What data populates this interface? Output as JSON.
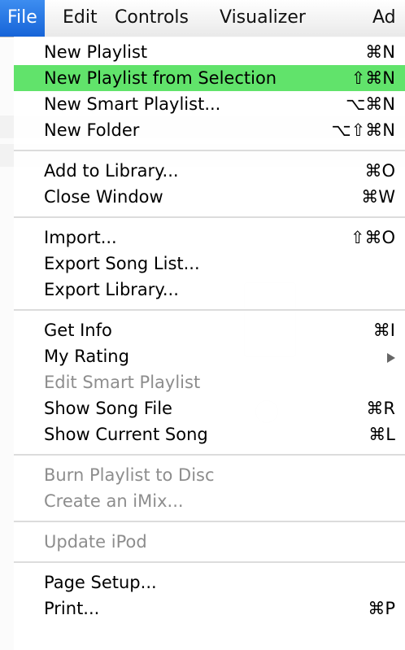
{
  "menubar": {
    "items": [
      "File",
      "Edit",
      "Controls",
      "Visualizer",
      "Ad"
    ]
  },
  "file_menu": {
    "groups": [
      [
        {
          "label": "New Playlist",
          "shortcut": "⌘N"
        },
        {
          "label": "New Playlist from Selection",
          "shortcut": "⇧⌘N",
          "highlighted": true
        },
        {
          "label": "New Smart Playlist...",
          "shortcut": "⌥⌘N"
        },
        {
          "label": "New Folder",
          "shortcut": "⌥⇧⌘N"
        }
      ],
      [
        {
          "label": "Add to Library...",
          "shortcut": "⌘O"
        },
        {
          "label": "Close Window",
          "shortcut": "⌘W"
        }
      ],
      [
        {
          "label": "Import...",
          "shortcut": "⇧⌘O"
        },
        {
          "label": "Export Song List...",
          "shortcut": ""
        },
        {
          "label": "Export Library...",
          "shortcut": ""
        }
      ],
      [
        {
          "label": "Get Info",
          "shortcut": "⌘I"
        },
        {
          "label": "My Rating",
          "shortcut": "",
          "submenu": true
        },
        {
          "label": "Edit Smart Playlist",
          "shortcut": "",
          "disabled": true
        },
        {
          "label": "Show Song File",
          "shortcut": "⌘R"
        },
        {
          "label": "Show Current Song",
          "shortcut": "⌘L"
        }
      ],
      [
        {
          "label": "Burn Playlist to Disc",
          "shortcut": "",
          "disabled": true
        },
        {
          "label": "Create an iMix...",
          "shortcut": "",
          "disabled": true
        }
      ],
      [
        {
          "label": "Update iPod",
          "shortcut": "",
          "disabled": true
        }
      ],
      [
        {
          "label": "Page Setup...",
          "shortcut": ""
        },
        {
          "label": "Print...",
          "shortcut": "⌘P"
        }
      ]
    ]
  },
  "colors": {
    "menubar_active": "#1f6fe0",
    "row_highlight": "#61e36b",
    "disabled_text": "#8d8d8d"
  }
}
